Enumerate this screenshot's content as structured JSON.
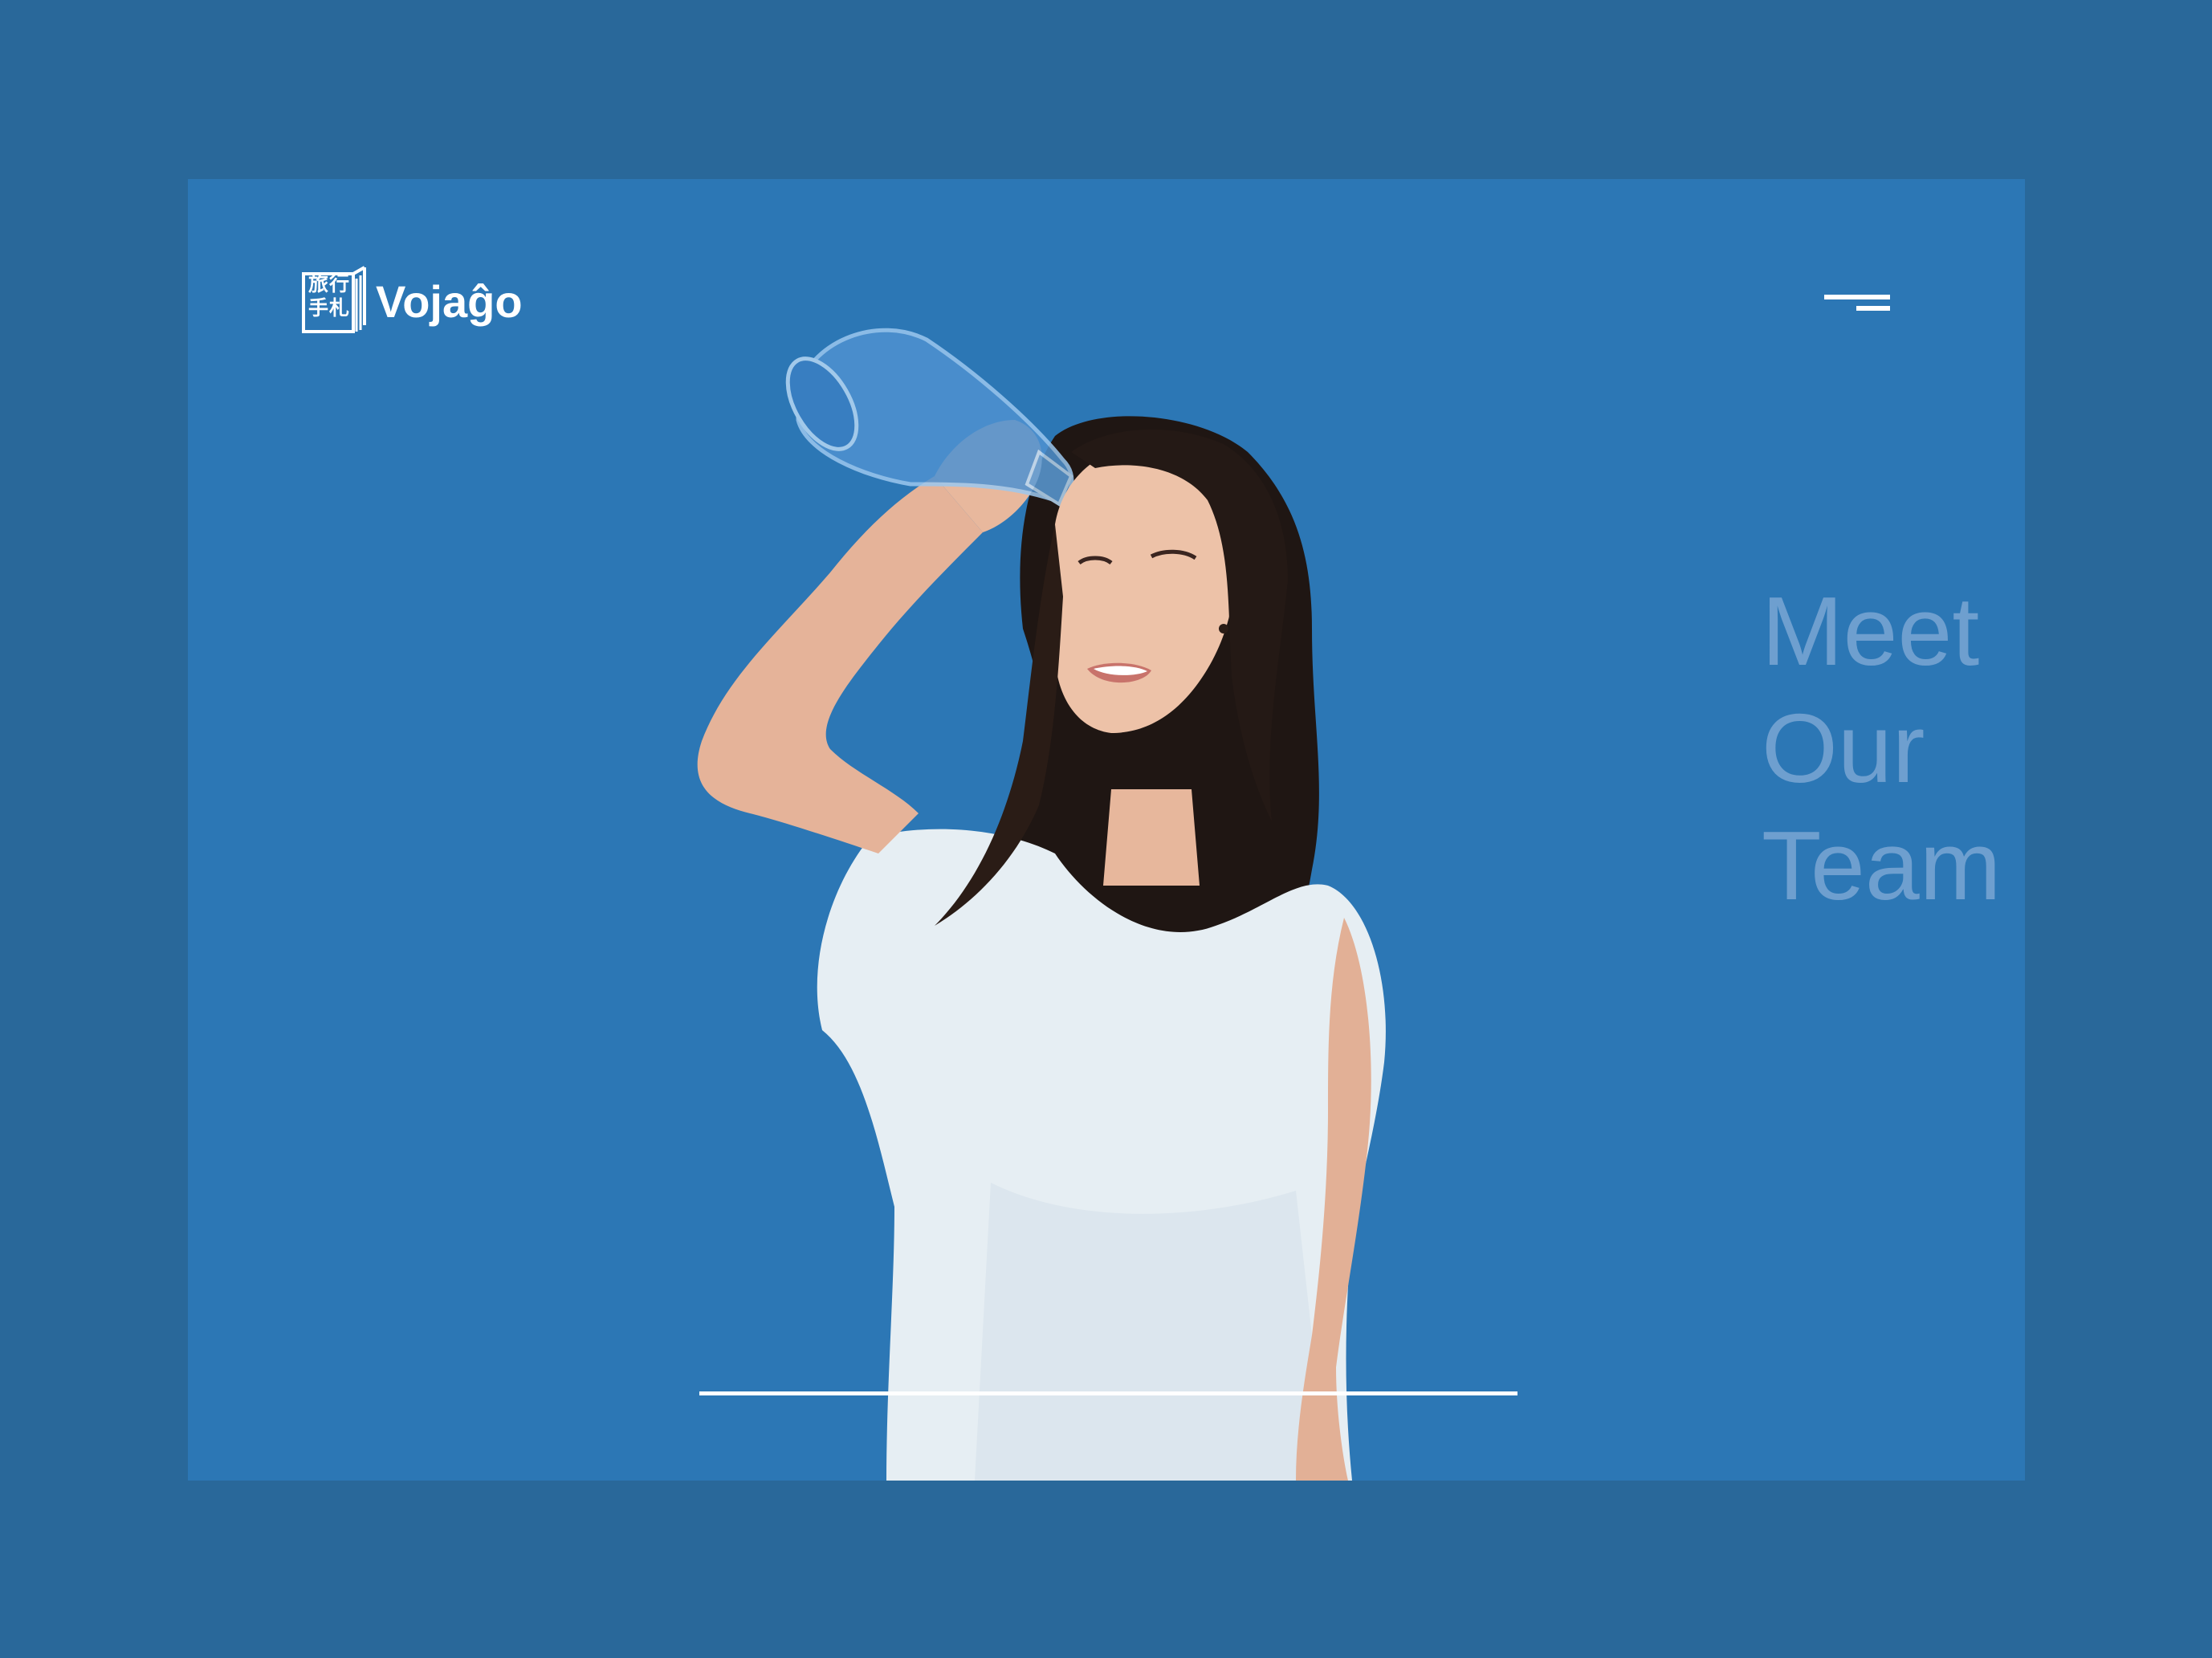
{
  "brand": {
    "logo_cjk": "旅行\n手札",
    "logo_word": "Vojaĝo"
  },
  "nav": {
    "menu_icon": "hamburger-menu-icon"
  },
  "hero": {
    "heading_lines": [
      "Meet",
      "Our",
      "Team"
    ],
    "image": "woman-holding-glass-flask"
  },
  "colors": {
    "outer_background": "#29689a",
    "frame_background": "#2c77b5",
    "heading": "#6e9fcf",
    "accent": "#ffffff"
  }
}
